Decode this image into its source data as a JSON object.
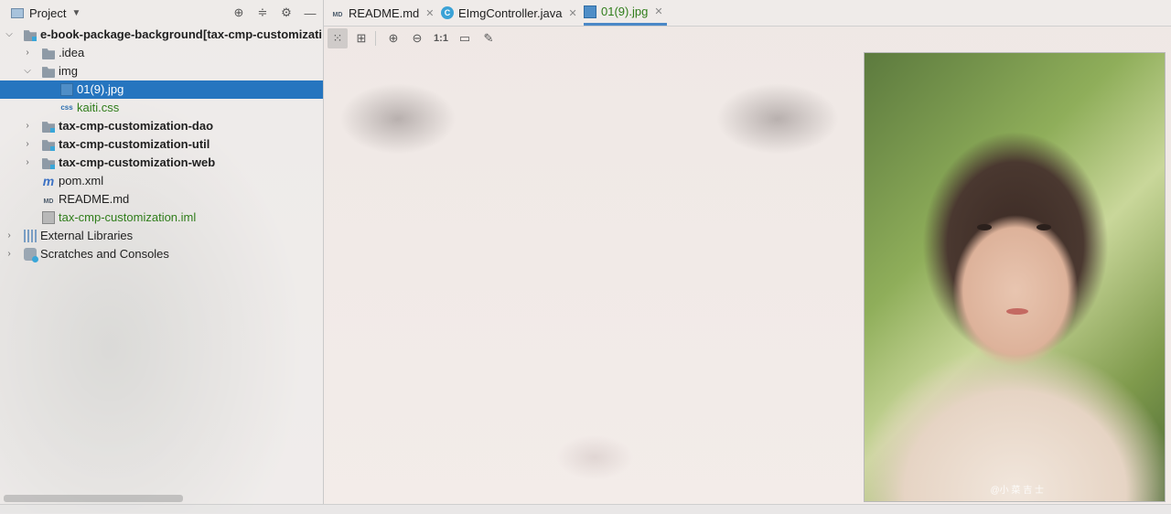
{
  "panel": {
    "title": "Project",
    "tools": [
      "crosshair-icon",
      "collapse-icon",
      "gear-icon",
      "minimize-icon"
    ]
  },
  "tree": [
    {
      "depth": 0,
      "expanded": true,
      "icon": "module-folder",
      "label": "e-book-package-background",
      "suffix": "[tax-cmp-customizati",
      "bold": true
    },
    {
      "depth": 1,
      "expanded": false,
      "icon": "folder",
      "label": ".idea"
    },
    {
      "depth": 1,
      "expanded": true,
      "icon": "folder",
      "label": "img"
    },
    {
      "depth": 2,
      "icon": "jpg",
      "label": "01(9).jpg",
      "selected": true
    },
    {
      "depth": 2,
      "icon": "css",
      "label": "kaiti.css",
      "green": true
    },
    {
      "depth": 1,
      "expanded": false,
      "icon": "module-folder",
      "label": "tax-cmp-customization-dao",
      "bold": true
    },
    {
      "depth": 1,
      "expanded": false,
      "icon": "module-folder",
      "label": "tax-cmp-customization-util",
      "bold": true
    },
    {
      "depth": 1,
      "expanded": false,
      "icon": "module-folder",
      "label": "tax-cmp-customization-web",
      "bold": true
    },
    {
      "depth": 1,
      "icon": "maven",
      "label": "pom.xml"
    },
    {
      "depth": 1,
      "icon": "md",
      "label": "README.md"
    },
    {
      "depth": 1,
      "icon": "iml",
      "label": "tax-cmp-customization.iml",
      "green": true
    },
    {
      "depth": 0,
      "expanded": false,
      "icon": "library",
      "label": "External Libraries"
    },
    {
      "depth": 0,
      "expanded": false,
      "icon": "scratch",
      "label": "Scratches and Consoles"
    }
  ],
  "tabs": [
    {
      "label": "README.md",
      "icon": "md",
      "active": false
    },
    {
      "label": "EImgController.java",
      "icon": "class",
      "active": false
    },
    {
      "label": "01(9).jpg",
      "icon": "jpg",
      "active": true
    }
  ],
  "image_toolbar": {
    "actual_size_label": "1:1"
  },
  "image": {
    "watermark": "@小 菜 吉 士"
  },
  "colors": {
    "selection": "#2675bf",
    "tab_underline": "#4a88c7",
    "green_text": "#2f7d1a"
  }
}
